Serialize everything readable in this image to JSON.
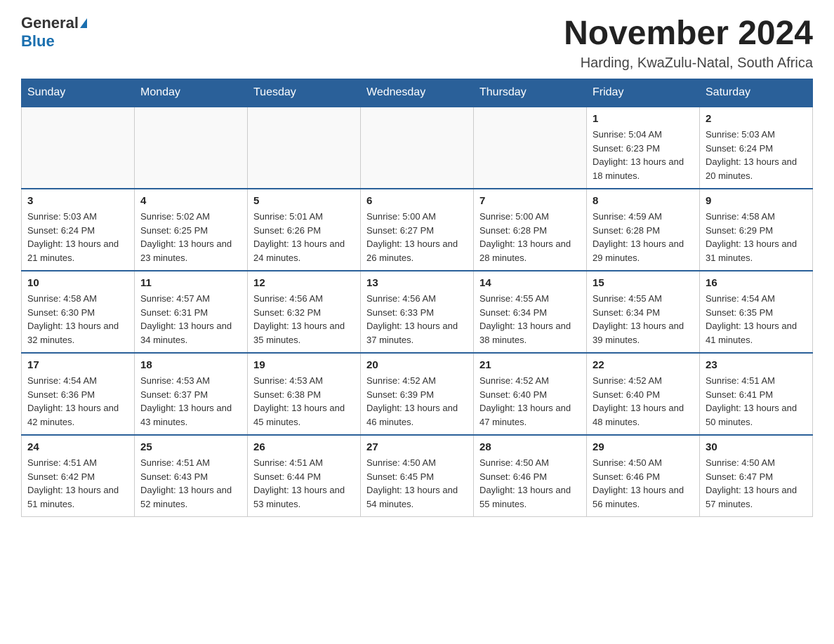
{
  "logo": {
    "general": "General",
    "blue": "Blue"
  },
  "title": "November 2024",
  "subtitle": "Harding, KwaZulu-Natal, South Africa",
  "headers": [
    "Sunday",
    "Monday",
    "Tuesday",
    "Wednesday",
    "Thursday",
    "Friday",
    "Saturday"
  ],
  "weeks": [
    [
      {
        "day": "",
        "info": ""
      },
      {
        "day": "",
        "info": ""
      },
      {
        "day": "",
        "info": ""
      },
      {
        "day": "",
        "info": ""
      },
      {
        "day": "",
        "info": ""
      },
      {
        "day": "1",
        "info": "Sunrise: 5:04 AM\nSunset: 6:23 PM\nDaylight: 13 hours and 18 minutes."
      },
      {
        "day": "2",
        "info": "Sunrise: 5:03 AM\nSunset: 6:24 PM\nDaylight: 13 hours and 20 minutes."
      }
    ],
    [
      {
        "day": "3",
        "info": "Sunrise: 5:03 AM\nSunset: 6:24 PM\nDaylight: 13 hours and 21 minutes."
      },
      {
        "day": "4",
        "info": "Sunrise: 5:02 AM\nSunset: 6:25 PM\nDaylight: 13 hours and 23 minutes."
      },
      {
        "day": "5",
        "info": "Sunrise: 5:01 AM\nSunset: 6:26 PM\nDaylight: 13 hours and 24 minutes."
      },
      {
        "day": "6",
        "info": "Sunrise: 5:00 AM\nSunset: 6:27 PM\nDaylight: 13 hours and 26 minutes."
      },
      {
        "day": "7",
        "info": "Sunrise: 5:00 AM\nSunset: 6:28 PM\nDaylight: 13 hours and 28 minutes."
      },
      {
        "day": "8",
        "info": "Sunrise: 4:59 AM\nSunset: 6:28 PM\nDaylight: 13 hours and 29 minutes."
      },
      {
        "day": "9",
        "info": "Sunrise: 4:58 AM\nSunset: 6:29 PM\nDaylight: 13 hours and 31 minutes."
      }
    ],
    [
      {
        "day": "10",
        "info": "Sunrise: 4:58 AM\nSunset: 6:30 PM\nDaylight: 13 hours and 32 minutes."
      },
      {
        "day": "11",
        "info": "Sunrise: 4:57 AM\nSunset: 6:31 PM\nDaylight: 13 hours and 34 minutes."
      },
      {
        "day": "12",
        "info": "Sunrise: 4:56 AM\nSunset: 6:32 PM\nDaylight: 13 hours and 35 minutes."
      },
      {
        "day": "13",
        "info": "Sunrise: 4:56 AM\nSunset: 6:33 PM\nDaylight: 13 hours and 37 minutes."
      },
      {
        "day": "14",
        "info": "Sunrise: 4:55 AM\nSunset: 6:34 PM\nDaylight: 13 hours and 38 minutes."
      },
      {
        "day": "15",
        "info": "Sunrise: 4:55 AM\nSunset: 6:34 PM\nDaylight: 13 hours and 39 minutes."
      },
      {
        "day": "16",
        "info": "Sunrise: 4:54 AM\nSunset: 6:35 PM\nDaylight: 13 hours and 41 minutes."
      }
    ],
    [
      {
        "day": "17",
        "info": "Sunrise: 4:54 AM\nSunset: 6:36 PM\nDaylight: 13 hours and 42 minutes."
      },
      {
        "day": "18",
        "info": "Sunrise: 4:53 AM\nSunset: 6:37 PM\nDaylight: 13 hours and 43 minutes."
      },
      {
        "day": "19",
        "info": "Sunrise: 4:53 AM\nSunset: 6:38 PM\nDaylight: 13 hours and 45 minutes."
      },
      {
        "day": "20",
        "info": "Sunrise: 4:52 AM\nSunset: 6:39 PM\nDaylight: 13 hours and 46 minutes."
      },
      {
        "day": "21",
        "info": "Sunrise: 4:52 AM\nSunset: 6:40 PM\nDaylight: 13 hours and 47 minutes."
      },
      {
        "day": "22",
        "info": "Sunrise: 4:52 AM\nSunset: 6:40 PM\nDaylight: 13 hours and 48 minutes."
      },
      {
        "day": "23",
        "info": "Sunrise: 4:51 AM\nSunset: 6:41 PM\nDaylight: 13 hours and 50 minutes."
      }
    ],
    [
      {
        "day": "24",
        "info": "Sunrise: 4:51 AM\nSunset: 6:42 PM\nDaylight: 13 hours and 51 minutes."
      },
      {
        "day": "25",
        "info": "Sunrise: 4:51 AM\nSunset: 6:43 PM\nDaylight: 13 hours and 52 minutes."
      },
      {
        "day": "26",
        "info": "Sunrise: 4:51 AM\nSunset: 6:44 PM\nDaylight: 13 hours and 53 minutes."
      },
      {
        "day": "27",
        "info": "Sunrise: 4:50 AM\nSunset: 6:45 PM\nDaylight: 13 hours and 54 minutes."
      },
      {
        "day": "28",
        "info": "Sunrise: 4:50 AM\nSunset: 6:46 PM\nDaylight: 13 hours and 55 minutes."
      },
      {
        "day": "29",
        "info": "Sunrise: 4:50 AM\nSunset: 6:46 PM\nDaylight: 13 hours and 56 minutes."
      },
      {
        "day": "30",
        "info": "Sunrise: 4:50 AM\nSunset: 6:47 PM\nDaylight: 13 hours and 57 minutes."
      }
    ]
  ]
}
